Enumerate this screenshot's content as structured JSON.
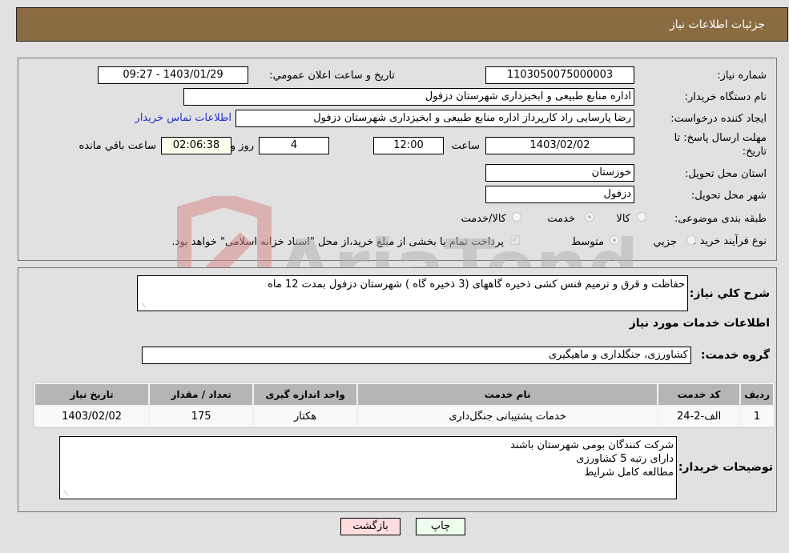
{
  "header": {
    "title": "جزئیات اطلاعات نیاز"
  },
  "form": {
    "need_number": {
      "label": "شماره نیاز:",
      "value": "1103050075000003"
    },
    "announce_datetime": {
      "label": "تاریخ و ساعت اعلان عمومي:",
      "value": "1403/01/29 - 09:27"
    },
    "buyer_org": {
      "label": "نام دستگاه خریدار:",
      "value": "اداره منابع طبیعی و ابخیزداری شهرستان دزفول"
    },
    "requester": {
      "label": "ایجاد کننده درخواست:",
      "value": "رضا پارسایی راد کارپرداز اداره منابع طبیعی و ابخیزداری شهرستان دزفول"
    },
    "buyer_contact_link": "اطلاعات تماس خریدار",
    "deadline": {
      "label_line1": "مهلت ارسال پاسخ: تا",
      "label_line2": "تاریخ:",
      "date": "1403/02/02",
      "time_label": "ساعت",
      "time": "12:00",
      "days": "4",
      "days_label": "روز و",
      "remaining": "02:06:38",
      "remaining_label": "ساعت باقي مانده"
    },
    "province": {
      "label": "استان محل تحویل:",
      "value": "خوزستان"
    },
    "city": {
      "label": "شهر محل تحویل:",
      "value": "دزفول"
    },
    "category": {
      "label": "طبقه بندی موضوعی:",
      "options": [
        "کالا",
        "خدمت",
        "کالا/خدمت"
      ],
      "selected": "خدمت"
    },
    "purchase_type": {
      "label": "نوع فرآیند خرید :",
      "options": [
        "جزيي",
        "متوسط"
      ],
      "selected": "متوسط",
      "treasury_note": "پرداخت تمام یا بخشی از مبلغ خرید،از محل \"اسناد خزانه اسلامی\" خواهد بود."
    }
  },
  "details": {
    "description_label": "شرح كلي نياز:",
    "description": "حفاظت و قرق و ترمیم فنس کشی ذخیره گاههای (3 ذخیره گاه ) شهرستان دزفول بمدت 12 ماه",
    "services_title": "اطلاعات خدمات مورد نیاز",
    "service_group_label": "گروه خدمت:",
    "service_group": "کشاورزی، جنگلداری و ماهیگیری",
    "table": {
      "headers": [
        "ردیف",
        "کد خدمت",
        "نام خدمت",
        "واحد اندازه گیری",
        "تعداد / مقدار",
        "تاریخ نیاز"
      ],
      "rows": [
        [
          "1",
          "الف-2-24",
          "خدمات پشتیبانی جنگل‌داری",
          "هکتار",
          "175",
          "1403/02/02"
        ]
      ]
    },
    "buyer_notes_label": "توضیحات خریدار:",
    "buyer_notes": [
      "شرکت کنندگان بومی شهرستان باشند",
      "دارای رتبه 5 کشاورزی",
      "مطالعه کامل شرایط"
    ]
  },
  "buttons": {
    "print": "چاپ",
    "back": "بازگشت"
  },
  "watermark": {
    "text": "AriaTender.neT"
  }
}
